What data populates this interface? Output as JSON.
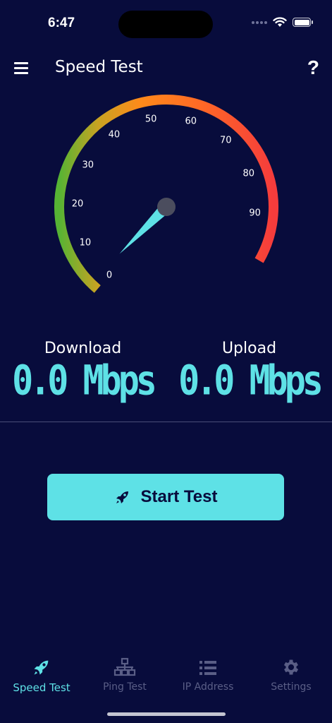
{
  "status": {
    "time": "6:47"
  },
  "app_bar": {
    "title": "Speed Test",
    "help_label": "?"
  },
  "gauge": {
    "ticks": [
      "0",
      "10",
      "20",
      "30",
      "40",
      "50",
      "60",
      "70",
      "80",
      "90"
    ],
    "min": 0,
    "max": 100,
    "value": 0,
    "needle_color": "#5ee1e6",
    "hub_color": "#4b4d5e",
    "gradient_colors": [
      "#56b334",
      "#e8a11a",
      "#ff8a1a",
      "#ff5a2a",
      "#f53c3c"
    ]
  },
  "readouts": {
    "download": {
      "label": "Download",
      "value": "0.0 Mbps"
    },
    "upload": {
      "label": "Upload",
      "value": "0.0 Mbps"
    }
  },
  "start_button": {
    "label": "Start Test",
    "icon": "rocket-icon"
  },
  "tabs": [
    {
      "label": "Speed Test",
      "icon": "rocket-icon",
      "active": true
    },
    {
      "label": "Ping Test",
      "icon": "network-icon",
      "active": false
    },
    {
      "label": "IP Address",
      "icon": "list-icon",
      "active": false
    },
    {
      "label": "Settings",
      "icon": "gear-icon",
      "active": false
    }
  ],
  "colors": {
    "background": "#080c3c",
    "accent": "#5ee1e6",
    "inactive": "#5a5e86"
  }
}
